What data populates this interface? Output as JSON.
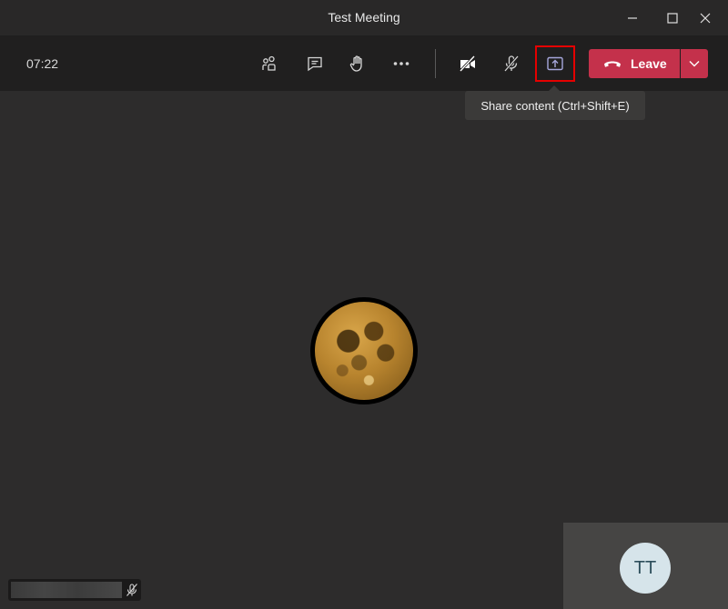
{
  "window": {
    "title": "Test Meeting",
    "controls": [
      "minimize-icon",
      "maximize-icon",
      "close-icon"
    ]
  },
  "toolbar": {
    "timer": "07:22",
    "buttons": [
      {
        "icon": "participants-icon"
      },
      {
        "icon": "chat-icon"
      },
      {
        "icon": "raise-hand-icon"
      },
      {
        "icon": "more-actions-icon"
      },
      {
        "icon": "camera-off-icon"
      },
      {
        "icon": "mic-off-icon"
      },
      {
        "icon": "share-content-icon",
        "highlighted": true
      }
    ],
    "leave_label": "Leave",
    "leave_color": "#c4314b"
  },
  "tooltip": {
    "text": "Share content (Ctrl+Shift+E)"
  },
  "stage": {
    "main_participant": {
      "avatar": "moon-image"
    },
    "self_view": {
      "initials": "TT"
    },
    "name_label": {
      "mic": "mic-off-icon"
    }
  },
  "colors": {
    "background": "#2d2c2c",
    "toolbar": "#201f1f",
    "highlight": "#e50000",
    "share_icon": "#a6a7dc"
  }
}
